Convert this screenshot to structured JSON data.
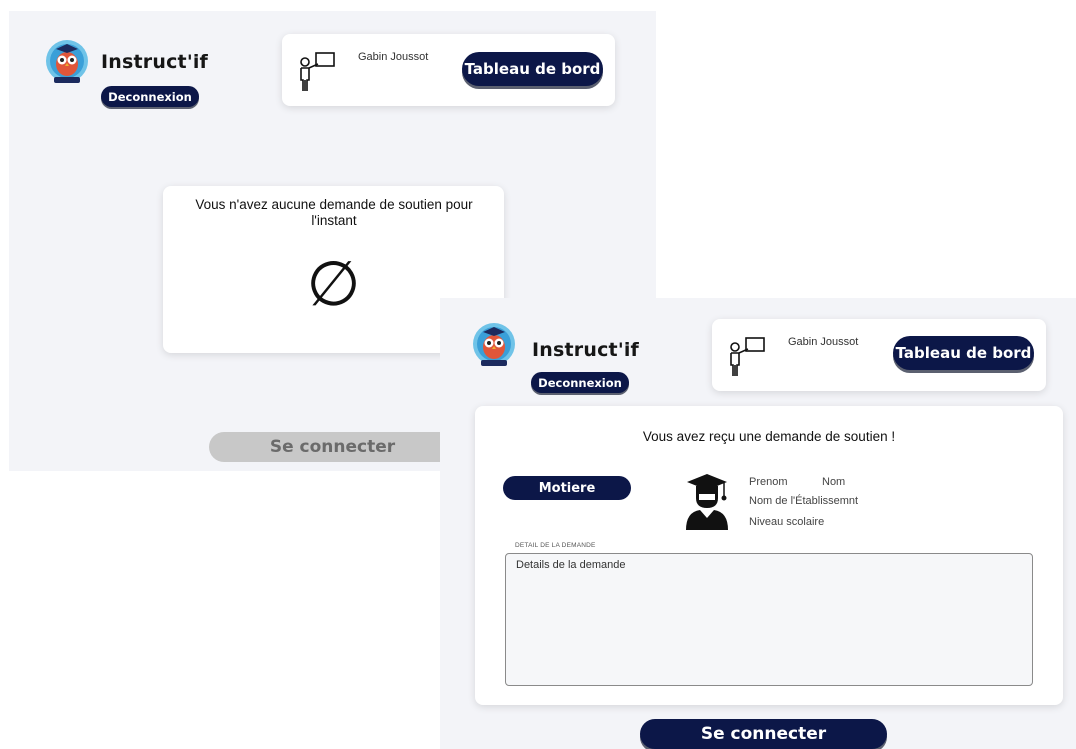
{
  "screen_empty": {
    "brand": "Instruct'if",
    "logout_label": "Deconnexion",
    "teacher_name": "Gabin Joussot",
    "dashboard_label": "Tableau de bord",
    "empty_message": "Vous n'avez aucune demande de soutien pour l'instant",
    "empty_symbol": "∅",
    "connect_label": "Se connecter"
  },
  "screen_request": {
    "brand": "Instruct'if",
    "logout_label": "Deconnexion",
    "teacher_name": "Gabin Joussot",
    "dashboard_label": "Tableau de bord",
    "request_title": "Vous avez reçu une demande de soutien !",
    "subject_label": "Motiere",
    "student": {
      "firstname": "Prenom",
      "lastname": "Nom",
      "school": "Nom de l'Établissemnt",
      "level": "Niveau scolaire"
    },
    "details_caption": "DETAIL DE LA DEMANDE",
    "details_value": "Details de la demande",
    "connect_label": "Se connecter"
  },
  "colors": {
    "navy": "#0c1748",
    "background": "#f3f4f8",
    "disabled_button": "#c8c8c8"
  }
}
